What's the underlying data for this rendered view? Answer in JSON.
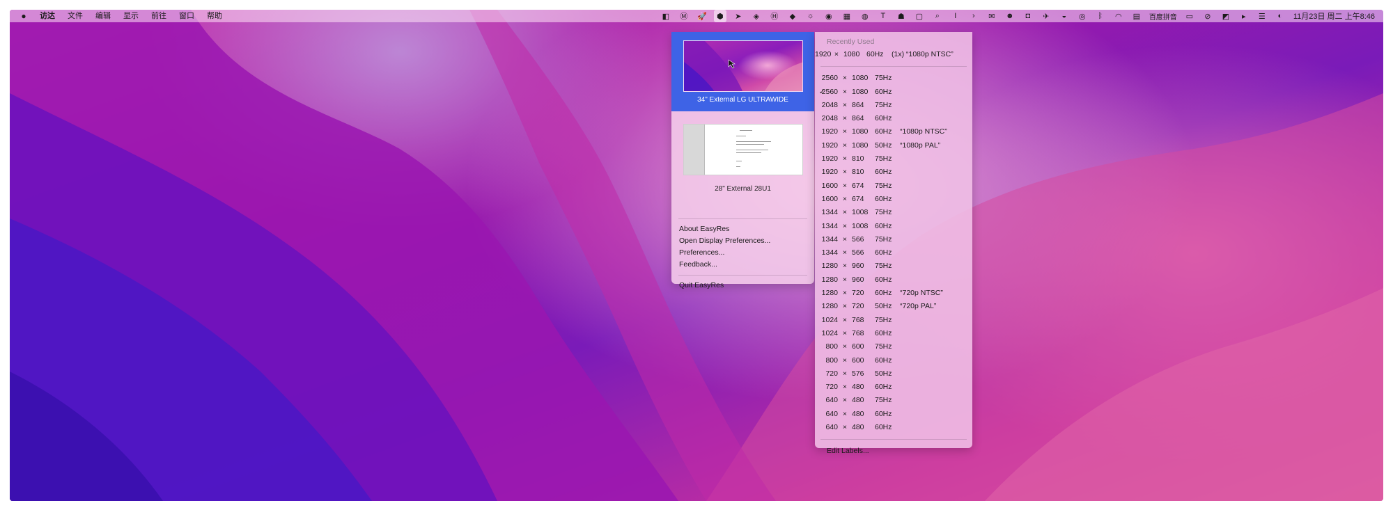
{
  "menubar": {
    "apple_icon": "apple-logo-icon",
    "items": [
      {
        "label": "访达",
        "bold": true
      },
      {
        "label": "文件"
      },
      {
        "label": "编辑"
      },
      {
        "label": "显示"
      },
      {
        "label": "前往"
      },
      {
        "label": "窗口"
      },
      {
        "label": "帮助"
      }
    ],
    "tray": [
      {
        "name": "bartender-icon",
        "glyph": "◧"
      },
      {
        "name": "m-app-icon",
        "glyph": "Ⓜ"
      },
      {
        "name": "rocket-icon",
        "glyph": "🚀"
      },
      {
        "name": "easyres-icon",
        "glyph": "⬢",
        "active": true
      },
      {
        "name": "send-icon",
        "glyph": "➤"
      },
      {
        "name": "layers-icon",
        "glyph": "◈"
      },
      {
        "name": "h-app-icon",
        "glyph": "Ⓗ"
      },
      {
        "name": "qq-icon",
        "glyph": "◆"
      },
      {
        "name": "brightness-icon",
        "glyph": "☼"
      },
      {
        "name": "speed-icon",
        "glyph": "◉"
      },
      {
        "name": "grid-icon",
        "glyph": "▦"
      },
      {
        "name": "circle-app-icon",
        "glyph": "◍"
      },
      {
        "name": "text-tool-icon",
        "glyph": "T"
      },
      {
        "name": "hat-icon",
        "glyph": "☗"
      },
      {
        "name": "window-icon",
        "glyph": "▢"
      },
      {
        "name": "search-icon",
        "glyph": "⌕"
      },
      {
        "name": "cursor-icon",
        "glyph": "I"
      },
      {
        "name": "chevron-right-icon",
        "glyph": "›"
      },
      {
        "name": "mail-icon",
        "glyph": "✉"
      },
      {
        "name": "face-icon",
        "glyph": "☻"
      },
      {
        "name": "notification-icon",
        "glyph": "◘"
      },
      {
        "name": "bird-icon",
        "glyph": "✈"
      },
      {
        "name": "cat-icon",
        "glyph": "◒"
      },
      {
        "name": "wechat-icon",
        "glyph": "◎"
      },
      {
        "name": "bluetooth-icon",
        "glyph": "ᛒ"
      },
      {
        "name": "wifi-icon",
        "glyph": "◠"
      },
      {
        "name": "clipboard-icon",
        "glyph": "▤"
      }
    ],
    "input_method": "百度拼音",
    "tray_after": [
      {
        "name": "battery-icon",
        "glyph": "▭"
      },
      {
        "name": "mute-icon",
        "glyph": "⊘"
      },
      {
        "name": "contrast-icon",
        "glyph": "◩"
      },
      {
        "name": "play-icon",
        "glyph": "▸"
      },
      {
        "name": "control-center-icon",
        "glyph": "☰"
      },
      {
        "name": "siri-icon",
        "glyph": "◐"
      }
    ],
    "clock": "11月23日 周二 上午8:46"
  },
  "displays_panel": {
    "display1": "34\" External LG ULTRAWIDE",
    "display2": "28\" External 28U1",
    "items": [
      "About EasyRes",
      "Open Display Preferences...",
      "Preferences...",
      "Feedback..."
    ],
    "quit": "Quit EasyRes"
  },
  "resolutions_panel": {
    "recent_header": "Recently Used",
    "recent": {
      "w": "1920",
      "h": "1080",
      "hz": "60Hz",
      "extra": "(1x)  “1080p NTSC”"
    },
    "rows": [
      {
        "w": "2560",
        "h": "1080",
        "hz": "75Hz",
        "extra": ""
      },
      {
        "w": "2560",
        "h": "1080",
        "hz": "60Hz",
        "extra": "",
        "checked": true
      },
      {
        "w": "2048",
        "h": "864",
        "hz": "75Hz",
        "extra": ""
      },
      {
        "w": "2048",
        "h": "864",
        "hz": "60Hz",
        "extra": ""
      },
      {
        "w": "1920",
        "h": "1080",
        "hz": "60Hz",
        "extra": "“1080p NTSC”"
      },
      {
        "w": "1920",
        "h": "1080",
        "hz": "50Hz",
        "extra": "“1080p PAL”"
      },
      {
        "w": "1920",
        "h": "810",
        "hz": "75Hz",
        "extra": ""
      },
      {
        "w": "1920",
        "h": "810",
        "hz": "60Hz",
        "extra": ""
      },
      {
        "w": "1600",
        "h": "674",
        "hz": "75Hz",
        "extra": ""
      },
      {
        "w": "1600",
        "h": "674",
        "hz": "60Hz",
        "extra": ""
      },
      {
        "w": "1344",
        "h": "1008",
        "hz": "75Hz",
        "extra": ""
      },
      {
        "w": "1344",
        "h": "1008",
        "hz": "60Hz",
        "extra": ""
      },
      {
        "w": "1344",
        "h": "566",
        "hz": "75Hz",
        "extra": ""
      },
      {
        "w": "1344",
        "h": "566",
        "hz": "60Hz",
        "extra": ""
      },
      {
        "w": "1280",
        "h": "960",
        "hz": "75Hz",
        "extra": ""
      },
      {
        "w": "1280",
        "h": "960",
        "hz": "60Hz",
        "extra": ""
      },
      {
        "w": "1280",
        "h": "720",
        "hz": "60Hz",
        "extra": "“720p NTSC”"
      },
      {
        "w": "1280",
        "h": "720",
        "hz": "50Hz",
        "extra": "“720p PAL”"
      },
      {
        "w": "1024",
        "h": "768",
        "hz": "75Hz",
        "extra": ""
      },
      {
        "w": "1024",
        "h": "768",
        "hz": "60Hz",
        "extra": ""
      },
      {
        "w": "800",
        "h": "600",
        "hz": "75Hz",
        "extra": ""
      },
      {
        "w": "800",
        "h": "600",
        "hz": "60Hz",
        "extra": ""
      },
      {
        "w": "720",
        "h": "576",
        "hz": "50Hz",
        "extra": ""
      },
      {
        "w": "720",
        "h": "480",
        "hz": "60Hz",
        "extra": ""
      },
      {
        "w": "640",
        "h": "480",
        "hz": "75Hz",
        "extra": ""
      },
      {
        "w": "640",
        "h": "480",
        "hz": "60Hz",
        "extra": ""
      },
      {
        "w": "640",
        "h": "480",
        "hz": "60Hz",
        "extra": ""
      }
    ],
    "edit_labels": "Edit Labels...",
    "check_mark": "✓",
    "times": "×"
  },
  "colors": {
    "selected_display": "#3e63e6",
    "wallpaper_magenta": "#b81fa8",
    "wallpaper_purple": "#5a18c0"
  }
}
